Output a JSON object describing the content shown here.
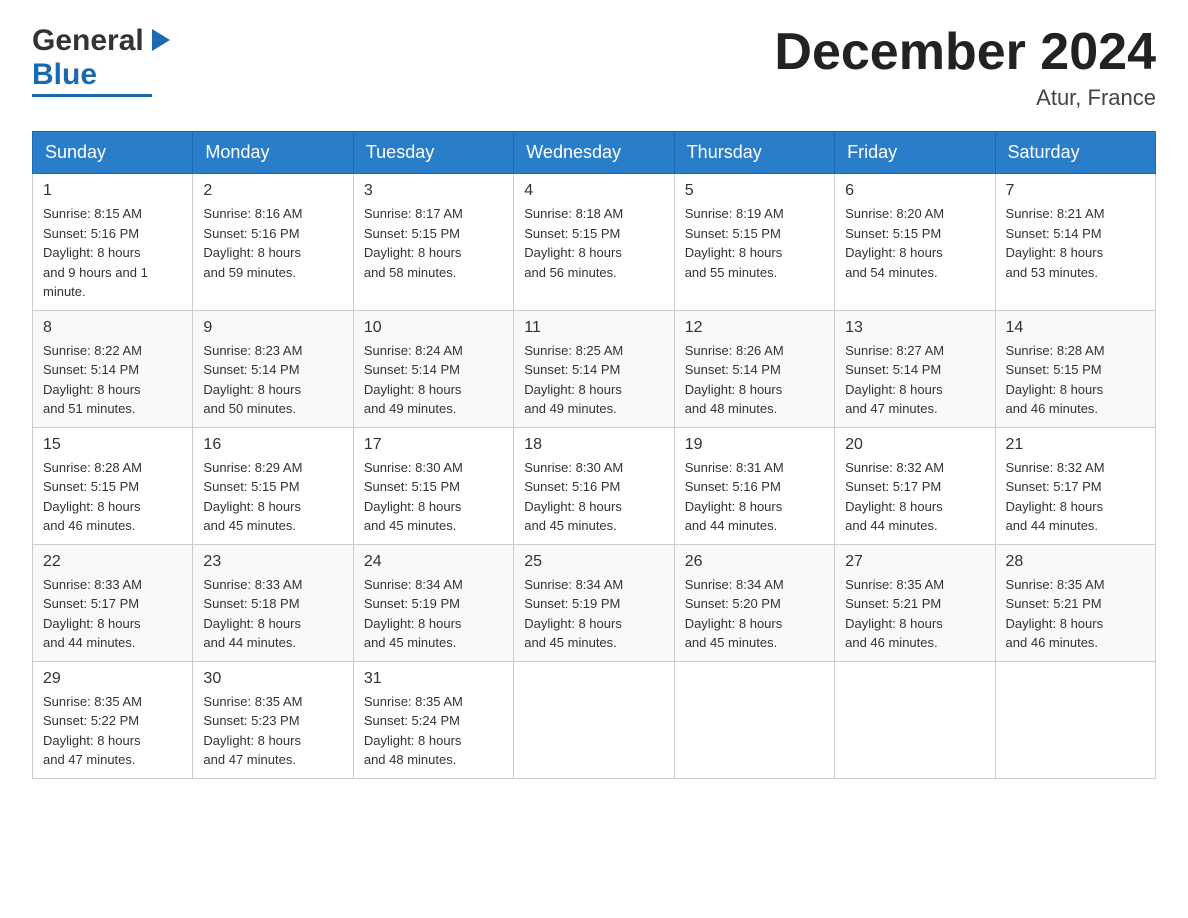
{
  "header": {
    "logo_general": "General",
    "logo_blue": "Blue",
    "month_title": "December 2024",
    "location": "Atur, France"
  },
  "days_of_week": [
    "Sunday",
    "Monday",
    "Tuesday",
    "Wednesday",
    "Thursday",
    "Friday",
    "Saturday"
  ],
  "weeks": [
    [
      {
        "date": "1",
        "sunrise": "8:15 AM",
        "sunset": "5:16 PM",
        "daylight": "9 hours and 1 minute."
      },
      {
        "date": "2",
        "sunrise": "8:16 AM",
        "sunset": "5:16 PM",
        "daylight": "8 hours and 59 minutes."
      },
      {
        "date": "3",
        "sunrise": "8:17 AM",
        "sunset": "5:15 PM",
        "daylight": "8 hours and 58 minutes."
      },
      {
        "date": "4",
        "sunrise": "8:18 AM",
        "sunset": "5:15 PM",
        "daylight": "8 hours and 56 minutes."
      },
      {
        "date": "5",
        "sunrise": "8:19 AM",
        "sunset": "5:15 PM",
        "daylight": "8 hours and 55 minutes."
      },
      {
        "date": "6",
        "sunrise": "8:20 AM",
        "sunset": "5:15 PM",
        "daylight": "8 hours and 54 minutes."
      },
      {
        "date": "7",
        "sunrise": "8:21 AM",
        "sunset": "5:14 PM",
        "daylight": "8 hours and 53 minutes."
      }
    ],
    [
      {
        "date": "8",
        "sunrise": "8:22 AM",
        "sunset": "5:14 PM",
        "daylight": "8 hours and 51 minutes."
      },
      {
        "date": "9",
        "sunrise": "8:23 AM",
        "sunset": "5:14 PM",
        "daylight": "8 hours and 50 minutes."
      },
      {
        "date": "10",
        "sunrise": "8:24 AM",
        "sunset": "5:14 PM",
        "daylight": "8 hours and 49 minutes."
      },
      {
        "date": "11",
        "sunrise": "8:25 AM",
        "sunset": "5:14 PM",
        "daylight": "8 hours and 49 minutes."
      },
      {
        "date": "12",
        "sunrise": "8:26 AM",
        "sunset": "5:14 PM",
        "daylight": "8 hours and 48 minutes."
      },
      {
        "date": "13",
        "sunrise": "8:27 AM",
        "sunset": "5:14 PM",
        "daylight": "8 hours and 47 minutes."
      },
      {
        "date": "14",
        "sunrise": "8:28 AM",
        "sunset": "5:15 PM",
        "daylight": "8 hours and 46 minutes."
      }
    ],
    [
      {
        "date": "15",
        "sunrise": "8:28 AM",
        "sunset": "5:15 PM",
        "daylight": "8 hours and 46 minutes."
      },
      {
        "date": "16",
        "sunrise": "8:29 AM",
        "sunset": "5:15 PM",
        "daylight": "8 hours and 45 minutes."
      },
      {
        "date": "17",
        "sunrise": "8:30 AM",
        "sunset": "5:15 PM",
        "daylight": "8 hours and 45 minutes."
      },
      {
        "date": "18",
        "sunrise": "8:30 AM",
        "sunset": "5:16 PM",
        "daylight": "8 hours and 45 minutes."
      },
      {
        "date": "19",
        "sunrise": "8:31 AM",
        "sunset": "5:16 PM",
        "daylight": "8 hours and 44 minutes."
      },
      {
        "date": "20",
        "sunrise": "8:32 AM",
        "sunset": "5:17 PM",
        "daylight": "8 hours and 44 minutes."
      },
      {
        "date": "21",
        "sunrise": "8:32 AM",
        "sunset": "5:17 PM",
        "daylight": "8 hours and 44 minutes."
      }
    ],
    [
      {
        "date": "22",
        "sunrise": "8:33 AM",
        "sunset": "5:17 PM",
        "daylight": "8 hours and 44 minutes."
      },
      {
        "date": "23",
        "sunrise": "8:33 AM",
        "sunset": "5:18 PM",
        "daylight": "8 hours and 44 minutes."
      },
      {
        "date": "24",
        "sunrise": "8:34 AM",
        "sunset": "5:19 PM",
        "daylight": "8 hours and 45 minutes."
      },
      {
        "date": "25",
        "sunrise": "8:34 AM",
        "sunset": "5:19 PM",
        "daylight": "8 hours and 45 minutes."
      },
      {
        "date": "26",
        "sunrise": "8:34 AM",
        "sunset": "5:20 PM",
        "daylight": "8 hours and 45 minutes."
      },
      {
        "date": "27",
        "sunrise": "8:35 AM",
        "sunset": "5:21 PM",
        "daylight": "8 hours and 46 minutes."
      },
      {
        "date": "28",
        "sunrise": "8:35 AM",
        "sunset": "5:21 PM",
        "daylight": "8 hours and 46 minutes."
      }
    ],
    [
      {
        "date": "29",
        "sunrise": "8:35 AM",
        "sunset": "5:22 PM",
        "daylight": "8 hours and 47 minutes."
      },
      {
        "date": "30",
        "sunrise": "8:35 AM",
        "sunset": "5:23 PM",
        "daylight": "8 hours and 47 minutes."
      },
      {
        "date": "31",
        "sunrise": "8:35 AM",
        "sunset": "5:24 PM",
        "daylight": "8 hours and 48 minutes."
      },
      null,
      null,
      null,
      null
    ]
  ],
  "labels": {
    "sunrise": "Sunrise:",
    "sunset": "Sunset:",
    "daylight": "Daylight:"
  }
}
